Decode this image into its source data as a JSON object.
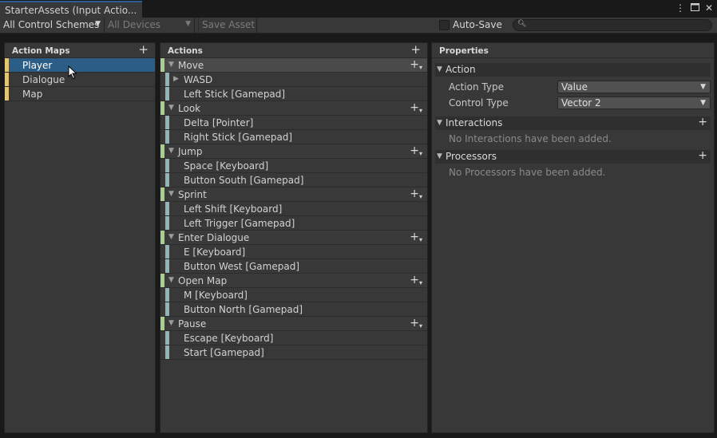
{
  "window": {
    "tab_title": "StarterAssets (Input Actio...",
    "menu_icon": "kebab-menu-icon",
    "maximize_icon": "maximize-icon",
    "close_icon": "close-icon"
  },
  "toolbar": {
    "control_scheme": "All Control Schemes",
    "devices": "All Devices",
    "save_asset": "Save Asset",
    "auto_save_label": "Auto-Save",
    "auto_save_checked": false,
    "search_value": ""
  },
  "maps_panel": {
    "header": "Action Maps",
    "items": [
      {
        "label": "Player",
        "selected": true
      },
      {
        "label": "Dialogue",
        "selected": false
      },
      {
        "label": "Map",
        "selected": false
      }
    ]
  },
  "actions_panel": {
    "header": "Actions",
    "actions": [
      {
        "label": "Move",
        "selected": true,
        "bindings": [
          {
            "label": "WASD",
            "composite": true
          },
          {
            "label": "Left Stick [Gamepad]",
            "composite": false
          }
        ]
      },
      {
        "label": "Look",
        "selected": false,
        "bindings": [
          {
            "label": "Delta [Pointer]",
            "composite": false
          },
          {
            "label": "Right Stick [Gamepad]",
            "composite": false
          }
        ]
      },
      {
        "label": "Jump",
        "selected": false,
        "bindings": [
          {
            "label": "Space [Keyboard]",
            "composite": false
          },
          {
            "label": "Button South [Gamepad]",
            "composite": false
          }
        ]
      },
      {
        "label": "Sprint",
        "selected": false,
        "bindings": [
          {
            "label": "Left Shift [Keyboard]",
            "composite": false
          },
          {
            "label": "Left Trigger [Gamepad]",
            "composite": false
          }
        ]
      },
      {
        "label": "Enter Dialogue",
        "selected": false,
        "bindings": [
          {
            "label": "E [Keyboard]",
            "composite": false
          },
          {
            "label": "Button West [Gamepad]",
            "composite": false
          }
        ]
      },
      {
        "label": "Open Map",
        "selected": false,
        "bindings": [
          {
            "label": "M [Keyboard]",
            "composite": false
          },
          {
            "label": "Button North [Gamepad]",
            "composite": false
          }
        ]
      },
      {
        "label": "Pause",
        "selected": false,
        "bindings": [
          {
            "label": "Escape [Keyboard]",
            "composite": false
          },
          {
            "label": "Start [Gamepad]",
            "composite": false
          }
        ]
      }
    ]
  },
  "properties_panel": {
    "header": "Properties",
    "action_section": "Action",
    "action_type_label": "Action Type",
    "action_type_value": "Value",
    "control_type_label": "Control Type",
    "control_type_value": "Vector 2",
    "interactions_section": "Interactions",
    "interactions_empty": "No Interactions have been added.",
    "processors_section": "Processors",
    "processors_empty": "No Processors have been added."
  },
  "colors": {
    "map_bar": "#e3c675",
    "action_bar": "#a7d08b",
    "binding_bar": "#8fb5b6",
    "selection": "#2c5d87",
    "tab_accent": "#2e5d92"
  }
}
